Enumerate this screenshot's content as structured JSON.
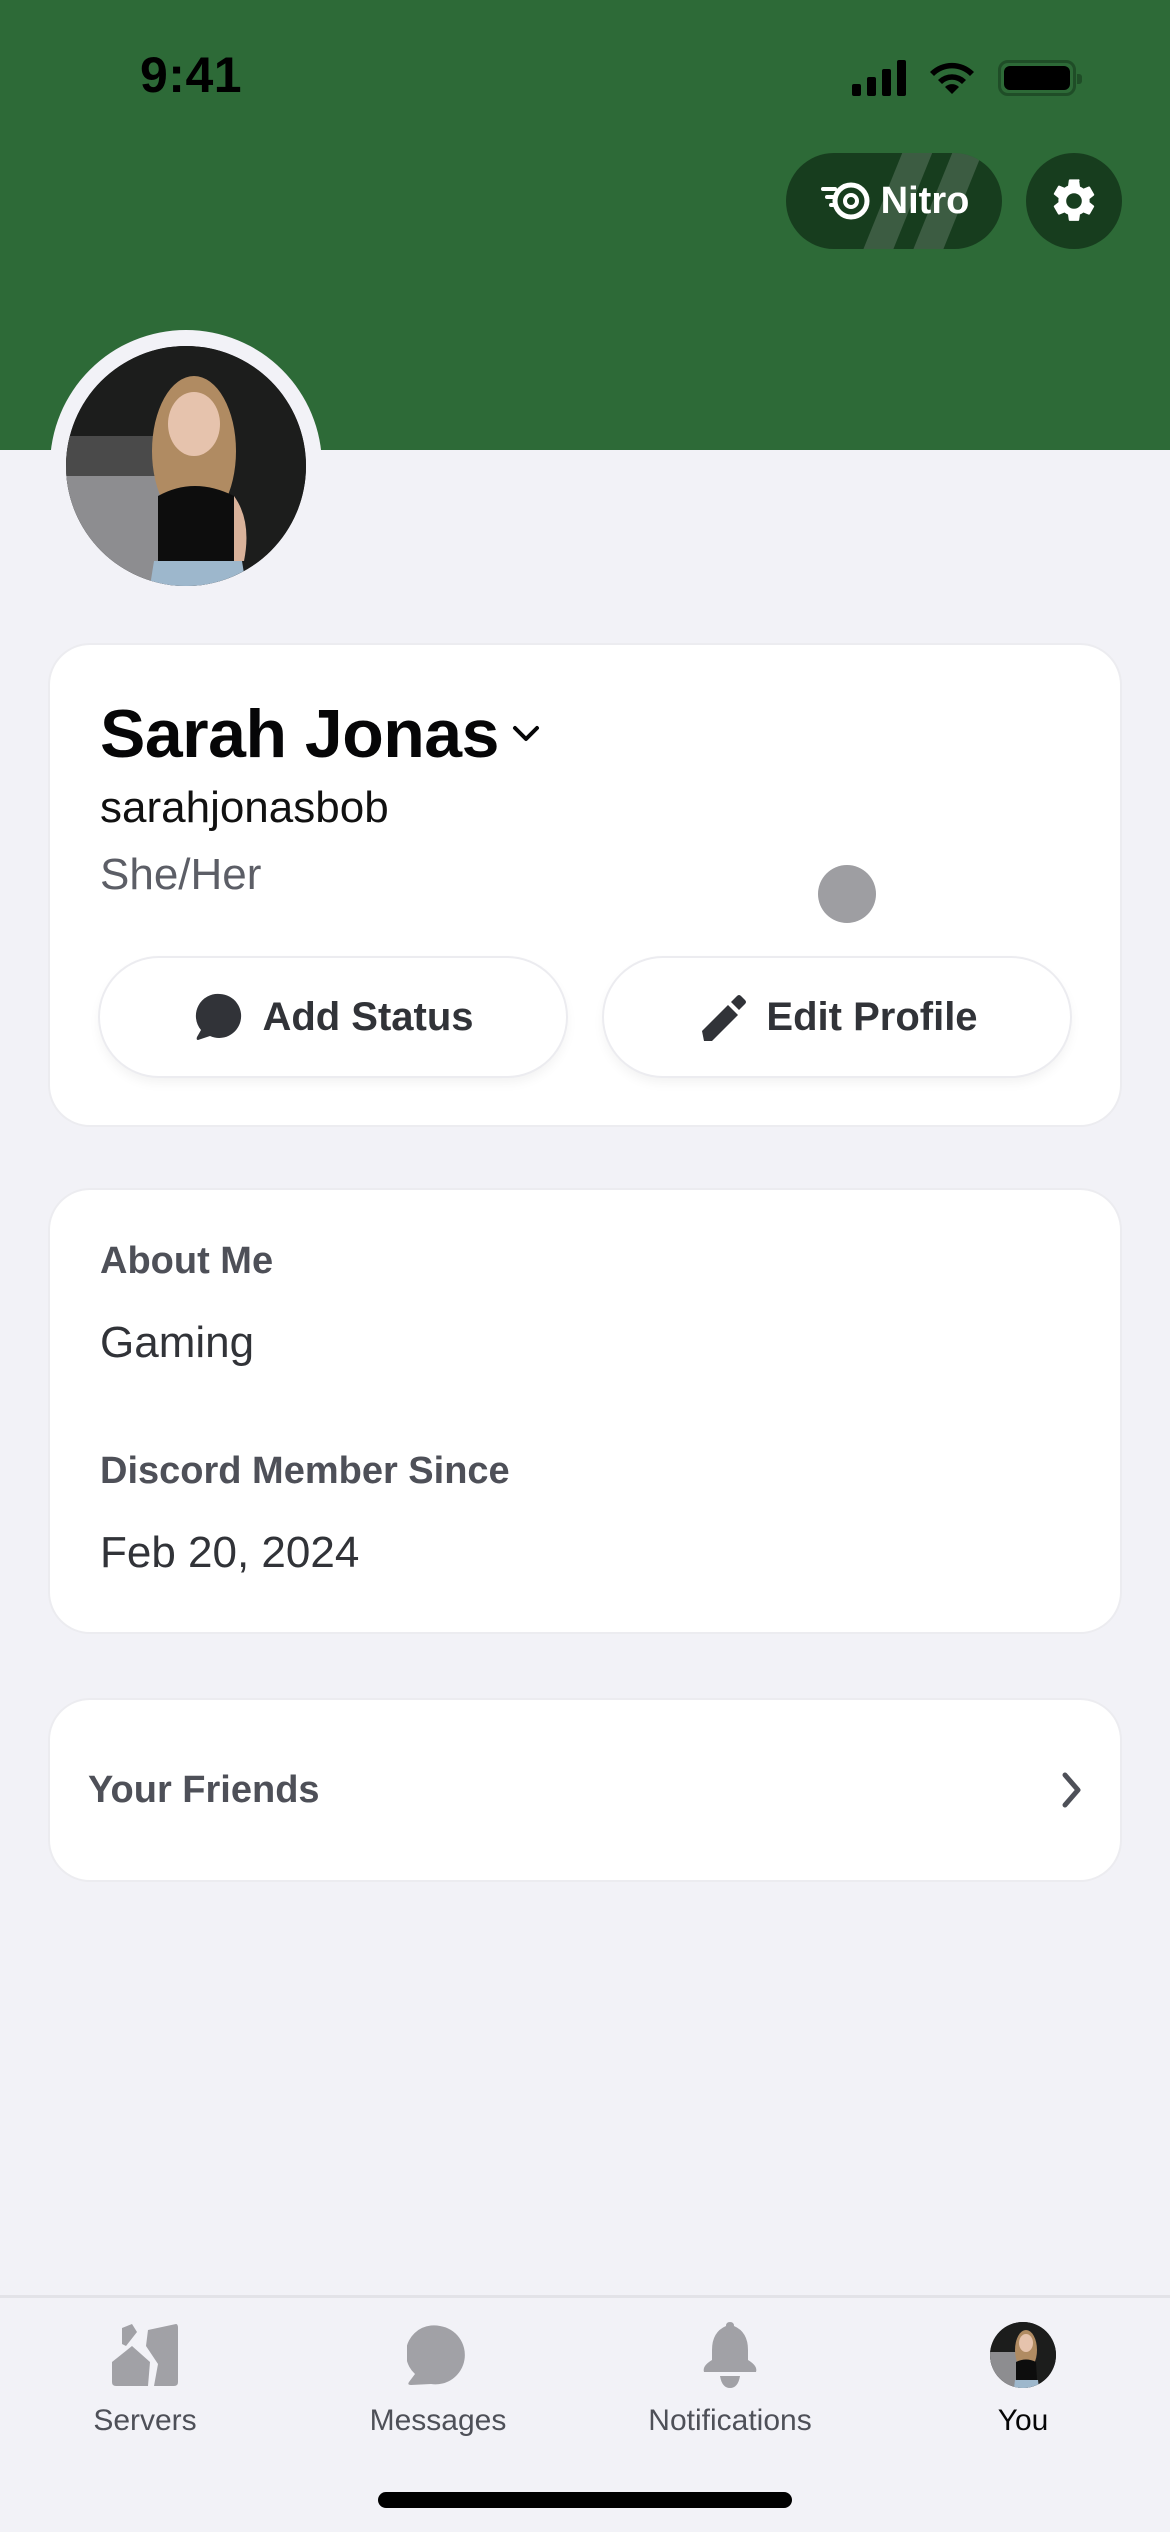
{
  "status_bar": {
    "time": "9:41",
    "icons": [
      "signal-icon",
      "wifi-icon",
      "battery-icon"
    ]
  },
  "header": {
    "banner_color": "#2d6a37",
    "nitro_button": {
      "label": "Nitro",
      "icon": "nitro-icon"
    },
    "settings_button": {
      "icon": "gear-icon"
    }
  },
  "profile": {
    "avatar": "profile-photo",
    "display_name": "Sarah Jonas",
    "username": "sarahjonasbob",
    "pronouns": "She/Her",
    "buttons": {
      "add_status": {
        "label": "Add Status",
        "icon": "chat-bubble-icon"
      },
      "edit_profile": {
        "label": "Edit Profile",
        "icon": "pencil-icon"
      }
    }
  },
  "about": {
    "about_me_label": "About Me",
    "about_me_value": "Gaming",
    "member_since_label": "Discord Member Since",
    "member_since_value": "Feb 20, 2024"
  },
  "friends": {
    "label": "Your Friends",
    "icon": "chevron-right-icon"
  },
  "bottom_nav": {
    "items": [
      {
        "label": "Servers",
        "icon": "servers-icon",
        "active": false
      },
      {
        "label": "Messages",
        "icon": "messages-icon",
        "active": false
      },
      {
        "label": "Notifications",
        "icon": "bell-icon",
        "active": false
      },
      {
        "label": "You",
        "icon": "avatar",
        "active": true
      }
    ]
  }
}
